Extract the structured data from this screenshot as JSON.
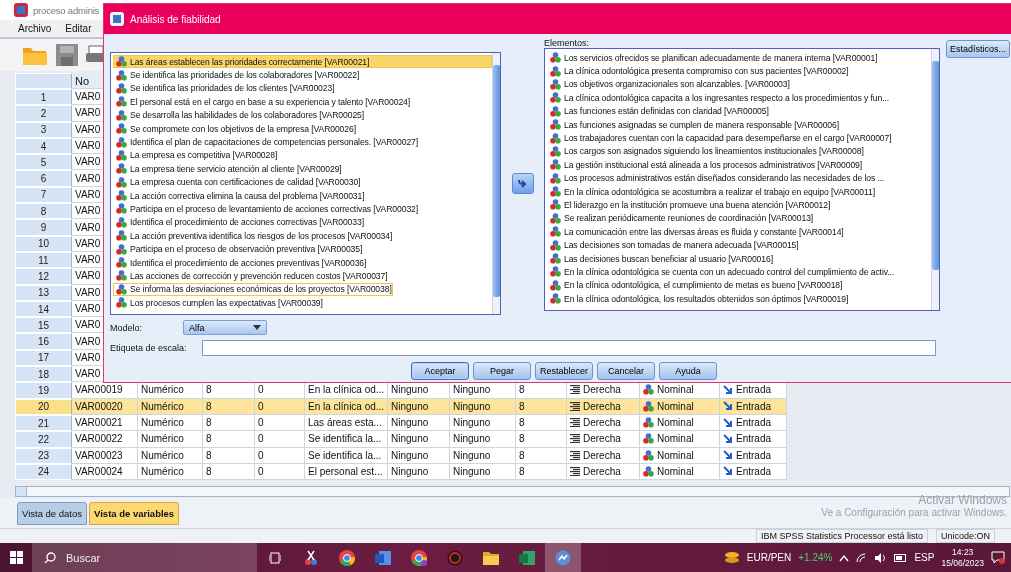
{
  "app": {
    "title": "proceso adminis",
    "menu": [
      {
        "label": "Archivo"
      },
      {
        "label": "Editar"
      }
    ]
  },
  "grid": {
    "columns": [
      {
        "label": "No"
      }
    ],
    "rows": [
      {
        "number": "1",
        "cells": [
          "VAR0"
        ],
        "selected": false
      },
      {
        "number": "2",
        "cells": [
          "VAR0"
        ],
        "selected": false
      },
      {
        "number": "3",
        "cells": [
          "VAR0"
        ],
        "selected": false
      },
      {
        "number": "4",
        "cells": [
          "VAR0"
        ],
        "selected": false
      },
      {
        "number": "5",
        "cells": [
          "VAR0"
        ],
        "selected": false
      },
      {
        "number": "6",
        "cells": [
          "VAR0"
        ],
        "selected": false
      },
      {
        "number": "7",
        "cells": [
          "VAR0"
        ],
        "selected": false
      },
      {
        "number": "8",
        "cells": [
          "VAR0"
        ],
        "selected": false
      },
      {
        "number": "9",
        "cells": [
          "VAR0"
        ],
        "selected": false
      },
      {
        "number": "10",
        "cells": [
          "VAR0"
        ],
        "selected": false
      },
      {
        "number": "11",
        "cells": [
          "VAR0"
        ],
        "selected": false
      },
      {
        "number": "12",
        "cells": [
          "VAR0"
        ],
        "selected": false
      },
      {
        "number": "13",
        "cells": [
          "VAR0"
        ],
        "selected": false
      },
      {
        "number": "14",
        "cells": [
          "VAR0"
        ],
        "selected": false
      },
      {
        "number": "15",
        "cells": [
          "VAR0"
        ],
        "selected": false
      },
      {
        "number": "16",
        "cells": [
          "VAR0"
        ],
        "selected": false
      },
      {
        "number": "17",
        "cells": [
          "VAR0"
        ],
        "selected": false
      },
      {
        "number": "18",
        "cells": [
          "VAR0"
        ],
        "selected": false
      },
      {
        "number": "19",
        "cells": [
          "VAR00019",
          "Numérico",
          "8",
          "0",
          "En la clínica od...",
          "Ninguno",
          "Ninguno",
          "8",
          "Derecha",
          "Nominal",
          "Entrada"
        ],
        "selected": false
      },
      {
        "number": "20",
        "cells": [
          "VAR00020",
          "Numérico",
          "8",
          "0",
          "En la clínica od...",
          "Ninguno",
          "Ninguno",
          "8",
          "Derecha",
          "Nominal",
          "Entrada"
        ],
        "selected": true
      },
      {
        "number": "21",
        "cells": [
          "VAR00021",
          "Numérico",
          "8",
          "0",
          "Las áreas esta...",
          "Ninguno",
          "Ninguno",
          "8",
          "Derecha",
          "Nominal",
          "Entrada"
        ],
        "selected": false
      },
      {
        "number": "22",
        "cells": [
          "VAR00022",
          "Numérico",
          "8",
          "0",
          "Se identifica la...",
          "Ninguno",
          "Ninguno",
          "8",
          "Derecha",
          "Nominal",
          "Entrada"
        ],
        "selected": false
      },
      {
        "number": "23",
        "cells": [
          "VAR00023",
          "Numérico",
          "8",
          "0",
          "Se identifica la...",
          "Ninguno",
          "Ninguno",
          "8",
          "Derecha",
          "Nominal",
          "Entrada"
        ],
        "selected": false
      },
      {
        "number": "24",
        "cells": [
          "VAR00024",
          "Numérico",
          "8",
          "0",
          "El personal est...",
          "Ninguno",
          "Ninguno",
          "8",
          "Derecha",
          "Nominal",
          "Entrada"
        ],
        "selected": false
      }
    ]
  },
  "view_tabs": [
    {
      "label": "Vista de datos",
      "selected": false
    },
    {
      "label": "Vista de variables",
      "selected": true
    }
  ],
  "activation_notice": {
    "title": "Activar Windows",
    "text": "Ve a Configuración para activar Windows."
  },
  "status_bar": {
    "message": "IBM SPSS Statistics Processor está listo",
    "encoding": "Unicode:ON"
  },
  "dialog": {
    "title": "Análisis de fiabilidad",
    "variables": [
      {
        "label": "Las áreas establecen las prioridades correctamente [VAR00021]",
        "selected": true,
        "focused": false
      },
      {
        "label": "Se identifica las prioridades de los colaboradores [VAR00022]",
        "selected": false,
        "focused": false
      },
      {
        "label": "Se identifica las prioridades de los clientes [VAR00023]",
        "selected": false,
        "focused": false
      },
      {
        "label": "El personal está en el cargo en base a su experiencia y talento [VAR00024]",
        "selected": false,
        "focused": false
      },
      {
        "label": "Se desarrolla las habilidades de los colaboradores [VAR00025]",
        "selected": false,
        "focused": false
      },
      {
        "label": "Se compromete con los objetivos de la empresa [VAR00026]",
        "selected": false,
        "focused": false
      },
      {
        "label": "Identifica el plan de capacitaciones de competencias personales. [VAR00027]",
        "selected": false,
        "focused": false
      },
      {
        "label": "La empresa es competitiva [VAR00028]",
        "selected": false,
        "focused": false
      },
      {
        "label": "La empresa tiene servicio atención al cliente [VAR00029]",
        "selected": false,
        "focused": false
      },
      {
        "label": "La empresa cuenta con certificaciones de calidad [VAR00030]",
        "selected": false,
        "focused": false
      },
      {
        "label": "La acción correctiva elimina la causa del problema [VAR00031]",
        "selected": false,
        "focused": false
      },
      {
        "label": "Participa en el proceso de levantamiento de acciones correctivas [VAR00032]",
        "selected": false,
        "focused": false
      },
      {
        "label": "Identifica el procedimiento de acciones correctivas [VAR00033]",
        "selected": false,
        "focused": false
      },
      {
        "label": "La acción preventiva identifica los riesgos de los procesos [VAR00034]",
        "selected": false,
        "focused": false
      },
      {
        "label": "Participa en el proceso de observación preventiva [VAR00035]",
        "selected": false,
        "focused": false
      },
      {
        "label": "Identifica el procedimiento de acciones preventivas [VAR00036]",
        "selected": false,
        "focused": false
      },
      {
        "label": "Las acciones de corrección y prevención reducen costos [VAR00037]",
        "selected": false,
        "focused": false
      },
      {
        "label": "Se informa las desviaciones económicas de los proyectos [VAR00038]",
        "selected": false,
        "focused": true
      },
      {
        "label": "Los procesos cumplen las expectativas [VAR00039]",
        "selected": false,
        "focused": false
      }
    ],
    "items_label": "Elementos:",
    "items": [
      {
        "label": "Los servicios ofrecidos se planifican adecuadamente de manera interna  [VAR00001]"
      },
      {
        "label": "La clínica odontológica presenta compromiso con sus pacientes [VAR00002]"
      },
      {
        "label": "Los objetivos organizacionales son alcanzables. [VAR00003]"
      },
      {
        "label": "La clínica odontológica capacita a los ingresantes respecto a los procedimientos y fun..."
      },
      {
        "label": "Las funciones están definidas con claridad [VAR00005]"
      },
      {
        "label": "Las funciones asignadas se cumplen de manera responsable [VAR00006]"
      },
      {
        "label": "Los trabajadores cuentan con la capacidad para desempeñarse en el cargo [VAR00007]"
      },
      {
        "label": "Los cargos son asignados siguiendo los lineamientos institucionales [VAR00008]"
      },
      {
        "label": "La gestión institucional está alineada a los procesos administrativos [VAR00009]"
      },
      {
        "label": "Los procesos administrativos están diseñados considerando las necesidades de los ..."
      },
      {
        "label": "En la clínica odontológica se acostumbra a realizar el trabajo en equipo [VAR00011]"
      },
      {
        "label": "El liderazgo en la institución promueve una buena atención [VAR00012]"
      },
      {
        "label": "Se realizan periódicamente reuniones de coordinación [VAR00013]"
      },
      {
        "label": "La comunicación entre las diversas áreas es fluida y constante [VAR00014]"
      },
      {
        "label": "Las decisiones son tomadas de manera adecuada [VAR00015]"
      },
      {
        "label": "Las decisiones buscan beneficiar al usuario [VAR00016]"
      },
      {
        "label": "En la clínica odontológica se cuenta con un adecuado control del cumplimiento de activ..."
      },
      {
        "label": "En la clínica odontológica, el cumplimiento de metas es bueno [VAR00018]"
      },
      {
        "label": "En la clínica odontológica, los resultados obtenidos son óptimos [VAR00019]"
      }
    ],
    "statistics_button": "Estadísticos...",
    "model": {
      "label": "Modelo:",
      "value": "Alfa"
    },
    "scale_label": {
      "label": "Etiqueta de escala:"
    },
    "buttons": [
      {
        "label": "Aceptar",
        "default": true
      },
      {
        "label": "Pegar",
        "default": false
      },
      {
        "label": "Restablecer",
        "default": false
      },
      {
        "label": "Cancelar",
        "default": false
      },
      {
        "label": "Ayuda",
        "default": false
      }
    ]
  },
  "taskbar": {
    "search_placeholder": "Buscar",
    "ticker": {
      "pair": "EUR/PEN",
      "change": "+1.24%"
    },
    "language": "ESP",
    "time": "14:23",
    "date": "15/06/2023"
  }
}
